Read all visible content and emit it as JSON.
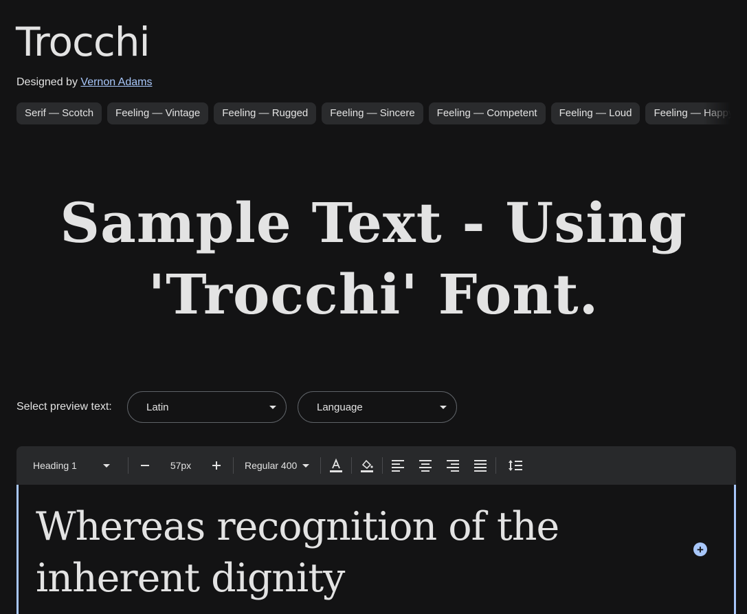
{
  "font": {
    "name": "Trocchi",
    "designed_by_label": "Designed by",
    "designer": "Vernon Adams"
  },
  "tags": [
    "Serif — Scotch",
    "Feeling — Vintage",
    "Feeling — Rugged",
    "Feeling — Sincere",
    "Feeling — Competent",
    "Feeling — Loud",
    "Feeling — Happy"
  ],
  "sample": {
    "line1": "Sample Text - Using",
    "line2": "'Trocchi' Font."
  },
  "preview": {
    "label": "Select preview text:",
    "script_select": "Latin",
    "language_select": "Language"
  },
  "toolbar": {
    "style": "Heading 1",
    "size": "57px",
    "weight": "Regular 400",
    "icons": [
      "text-color-icon",
      "fill-color-icon",
      "align-left-icon",
      "align-center-icon",
      "align-right-icon",
      "align-justify-icon",
      "line-height-icon"
    ]
  },
  "editor": {
    "line1": "Whereas recognition of the",
    "line2": "inherent dignity"
  },
  "colors": {
    "background": "#131314",
    "text": "#e3e3e3",
    "link": "#a8c7fa",
    "chip": "#2a2b2d",
    "toolbar": "#28292b",
    "accent": "#a8c7fa"
  }
}
